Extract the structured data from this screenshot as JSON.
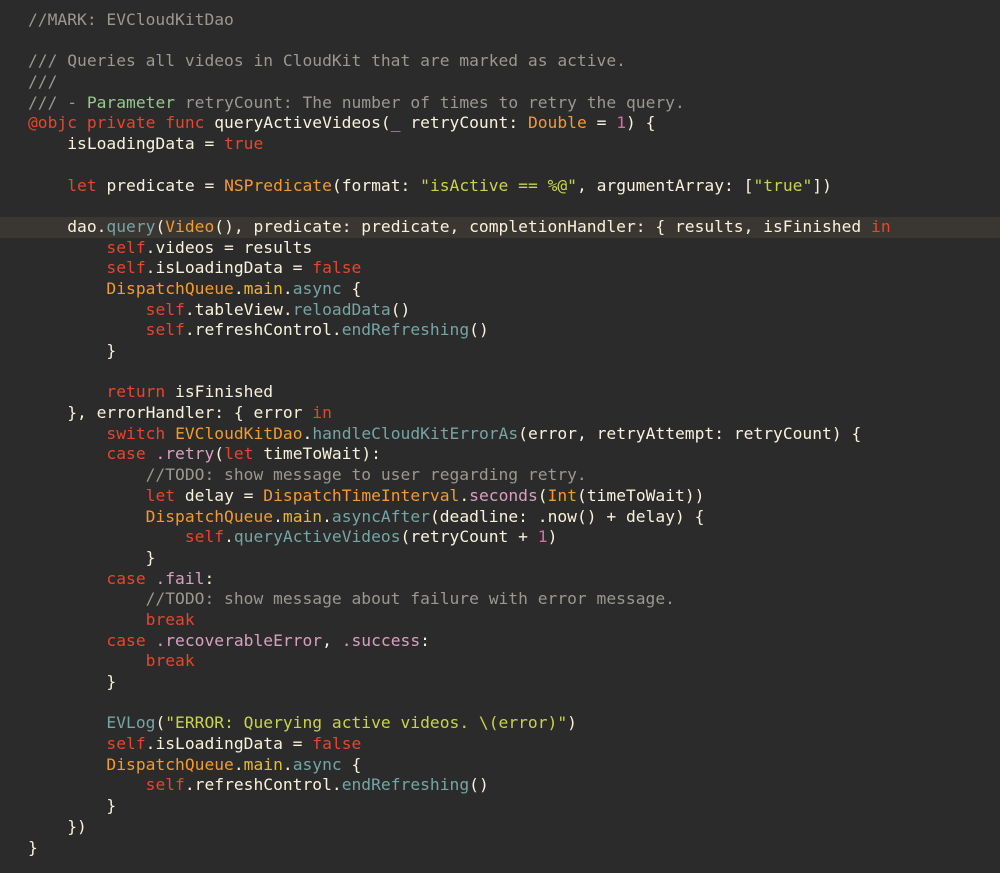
{
  "editor": {
    "language": "Swift",
    "theme": {
      "background": "#2b2b2b",
      "highlight_line_background": "#3a3632",
      "foreground": "#f8f2dc",
      "comment": "#9b9791",
      "keyword": "#e8452e",
      "type": "#f29b2e",
      "function": "#75a5a5",
      "string": "#c8d44a",
      "number": "#d96fa0",
      "enum_member": "#d8a0c0",
      "doc_param": "#96c98b",
      "property": "#e8b93a"
    },
    "highlighted_line_index": 10,
    "lines": [
      {
        "tokens": [
          {
            "t": "//MARK: EVCloudKitDao",
            "c": "comment"
          }
        ]
      },
      {
        "tokens": []
      },
      {
        "tokens": [
          {
            "t": "/// Queries all videos in CloudKit that are marked as active.",
            "c": "doc"
          }
        ]
      },
      {
        "tokens": [
          {
            "t": "///",
            "c": "doc"
          }
        ]
      },
      {
        "tokens": [
          {
            "t": "/// - ",
            "c": "doc"
          },
          {
            "t": "Parameter",
            "c": "docparam"
          },
          {
            "t": " retryCount: The number of times to retry the query.",
            "c": "doc"
          }
        ]
      },
      {
        "tokens": [
          {
            "t": "@objc private func",
            "c": "keyword"
          },
          {
            "t": " queryActiveVideos(",
            "c": "plain"
          },
          {
            "t": "_",
            "c": "member"
          },
          {
            "t": " retryCount: ",
            "c": "plain"
          },
          {
            "t": "Double",
            "c": "type"
          },
          {
            "t": " = ",
            "c": "plain"
          },
          {
            "t": "1",
            "c": "number"
          },
          {
            "t": ") {",
            "c": "plain"
          }
        ]
      },
      {
        "tokens": [
          {
            "t": "    isLoadingData = ",
            "c": "plain"
          },
          {
            "t": "true",
            "c": "keyword"
          }
        ]
      },
      {
        "tokens": []
      },
      {
        "tokens": [
          {
            "t": "    ",
            "c": "plain"
          },
          {
            "t": "let",
            "c": "keyword"
          },
          {
            "t": " predicate = ",
            "c": "plain"
          },
          {
            "t": "NSPredicate",
            "c": "type"
          },
          {
            "t": "(format: ",
            "c": "plain"
          },
          {
            "t": "\"isActive == %@\"",
            "c": "string"
          },
          {
            "t": ", argumentArray: [",
            "c": "plain"
          },
          {
            "t": "\"true\"",
            "c": "string"
          },
          {
            "t": "])",
            "c": "plain"
          }
        ]
      },
      {
        "tokens": []
      },
      {
        "tokens": [
          {
            "t": "    dao.",
            "c": "plain"
          },
          {
            "t": "query",
            "c": "func"
          },
          {
            "t": "(",
            "c": "plain"
          },
          {
            "t": "Video",
            "c": "type"
          },
          {
            "t": "(), predicate: predicate, completionHandler: { results, isFinished ",
            "c": "plain"
          },
          {
            "t": "in",
            "c": "keyword"
          }
        ]
      },
      {
        "tokens": [
          {
            "t": "        ",
            "c": "plain"
          },
          {
            "t": "self",
            "c": "keyword"
          },
          {
            "t": ".videos = results",
            "c": "plain"
          }
        ]
      },
      {
        "tokens": [
          {
            "t": "        ",
            "c": "plain"
          },
          {
            "t": "self",
            "c": "keyword"
          },
          {
            "t": ".isLoadingData = ",
            "c": "plain"
          },
          {
            "t": "false",
            "c": "keyword"
          }
        ]
      },
      {
        "tokens": [
          {
            "t": "        ",
            "c": "plain"
          },
          {
            "t": "DispatchQueue",
            "c": "type"
          },
          {
            "t": ".",
            "c": "plain"
          },
          {
            "t": "main",
            "c": "prop"
          },
          {
            "t": ".",
            "c": "plain"
          },
          {
            "t": "async",
            "c": "func"
          },
          {
            "t": " {",
            "c": "plain"
          }
        ]
      },
      {
        "tokens": [
          {
            "t": "            ",
            "c": "plain"
          },
          {
            "t": "self",
            "c": "keyword"
          },
          {
            "t": ".tableView.",
            "c": "plain"
          },
          {
            "t": "reloadData",
            "c": "func"
          },
          {
            "t": "()",
            "c": "plain"
          }
        ]
      },
      {
        "tokens": [
          {
            "t": "            ",
            "c": "plain"
          },
          {
            "t": "self",
            "c": "keyword"
          },
          {
            "t": ".refreshControl.",
            "c": "plain"
          },
          {
            "t": "endRefreshing",
            "c": "func"
          },
          {
            "t": "()",
            "c": "plain"
          }
        ]
      },
      {
        "tokens": [
          {
            "t": "        }",
            "c": "plain"
          }
        ]
      },
      {
        "tokens": []
      },
      {
        "tokens": [
          {
            "t": "        ",
            "c": "plain"
          },
          {
            "t": "return",
            "c": "keyword"
          },
          {
            "t": " isFinished",
            "c": "plain"
          }
        ]
      },
      {
        "tokens": [
          {
            "t": "    }, errorHandler: { error ",
            "c": "plain"
          },
          {
            "t": "in",
            "c": "keyword"
          }
        ]
      },
      {
        "tokens": [
          {
            "t": "        ",
            "c": "plain"
          },
          {
            "t": "switch",
            "c": "keyword"
          },
          {
            "t": " ",
            "c": "plain"
          },
          {
            "t": "EVCloudKitDao",
            "c": "type"
          },
          {
            "t": ".",
            "c": "plain"
          },
          {
            "t": "handleCloudKitErrorAs",
            "c": "func"
          },
          {
            "t": "(error, retryAttempt: retryCount) {",
            "c": "plain"
          }
        ]
      },
      {
        "tokens": [
          {
            "t": "        ",
            "c": "plain"
          },
          {
            "t": "case",
            "c": "keyword"
          },
          {
            "t": " ",
            "c": "plain"
          },
          {
            "t": ".retry",
            "c": "member"
          },
          {
            "t": "(",
            "c": "plain"
          },
          {
            "t": "let",
            "c": "keyword"
          },
          {
            "t": " timeToWait):",
            "c": "plain"
          }
        ]
      },
      {
        "tokens": [
          {
            "t": "            //TODO: show message to user regarding retry.",
            "c": "comment"
          }
        ]
      },
      {
        "tokens": [
          {
            "t": "            ",
            "c": "plain"
          },
          {
            "t": "let",
            "c": "keyword"
          },
          {
            "t": " delay = ",
            "c": "plain"
          },
          {
            "t": "DispatchTimeInterval",
            "c": "type"
          },
          {
            "t": ".",
            "c": "plain"
          },
          {
            "t": "seconds",
            "c": "member"
          },
          {
            "t": "(",
            "c": "plain"
          },
          {
            "t": "Int",
            "c": "type"
          },
          {
            "t": "(timeToWait))",
            "c": "plain"
          }
        ]
      },
      {
        "tokens": [
          {
            "t": "            ",
            "c": "plain"
          },
          {
            "t": "DispatchQueue",
            "c": "type"
          },
          {
            "t": ".",
            "c": "plain"
          },
          {
            "t": "main",
            "c": "prop"
          },
          {
            "t": ".",
            "c": "plain"
          },
          {
            "t": "asyncAfter",
            "c": "func"
          },
          {
            "t": "(deadline: .now() + delay) {",
            "c": "plain"
          }
        ]
      },
      {
        "tokens": [
          {
            "t": "                ",
            "c": "plain"
          },
          {
            "t": "self",
            "c": "keyword"
          },
          {
            "t": ".",
            "c": "plain"
          },
          {
            "t": "queryActiveVideos",
            "c": "func"
          },
          {
            "t": "(retryCount + ",
            "c": "plain"
          },
          {
            "t": "1",
            "c": "number"
          },
          {
            "t": ")",
            "c": "plain"
          }
        ]
      },
      {
        "tokens": [
          {
            "t": "            }",
            "c": "plain"
          }
        ]
      },
      {
        "tokens": [
          {
            "t": "        ",
            "c": "plain"
          },
          {
            "t": "case",
            "c": "keyword"
          },
          {
            "t": " ",
            "c": "plain"
          },
          {
            "t": ".fail",
            "c": "member"
          },
          {
            "t": ":",
            "c": "plain"
          }
        ]
      },
      {
        "tokens": [
          {
            "t": "            //TODO: show message about failure with error message.",
            "c": "comment"
          }
        ]
      },
      {
        "tokens": [
          {
            "t": "            ",
            "c": "plain"
          },
          {
            "t": "break",
            "c": "keyword"
          }
        ]
      },
      {
        "tokens": [
          {
            "t": "        ",
            "c": "plain"
          },
          {
            "t": "case",
            "c": "keyword"
          },
          {
            "t": " ",
            "c": "plain"
          },
          {
            "t": ".recoverableError",
            "c": "member"
          },
          {
            "t": ", ",
            "c": "plain"
          },
          {
            "t": ".success",
            "c": "member"
          },
          {
            "t": ":",
            "c": "plain"
          }
        ]
      },
      {
        "tokens": [
          {
            "t": "            ",
            "c": "plain"
          },
          {
            "t": "break",
            "c": "keyword"
          }
        ]
      },
      {
        "tokens": [
          {
            "t": "        }",
            "c": "plain"
          }
        ]
      },
      {
        "tokens": []
      },
      {
        "tokens": [
          {
            "t": "        ",
            "c": "plain"
          },
          {
            "t": "EVLog",
            "c": "func"
          },
          {
            "t": "(",
            "c": "plain"
          },
          {
            "t": "\"ERROR: Querying active videos. \\(error)\"",
            "c": "string"
          },
          {
            "t": ")",
            "c": "plain"
          }
        ]
      },
      {
        "tokens": [
          {
            "t": "        ",
            "c": "plain"
          },
          {
            "t": "self",
            "c": "keyword"
          },
          {
            "t": ".isLoadingData = ",
            "c": "plain"
          },
          {
            "t": "false",
            "c": "keyword"
          }
        ]
      },
      {
        "tokens": [
          {
            "t": "        ",
            "c": "plain"
          },
          {
            "t": "DispatchQueue",
            "c": "type"
          },
          {
            "t": ".",
            "c": "plain"
          },
          {
            "t": "main",
            "c": "prop"
          },
          {
            "t": ".",
            "c": "plain"
          },
          {
            "t": "async",
            "c": "func"
          },
          {
            "t": " {",
            "c": "plain"
          }
        ]
      },
      {
        "tokens": [
          {
            "t": "            ",
            "c": "plain"
          },
          {
            "t": "self",
            "c": "keyword"
          },
          {
            "t": ".refreshControl.",
            "c": "plain"
          },
          {
            "t": "endRefreshing",
            "c": "func"
          },
          {
            "t": "()",
            "c": "plain"
          }
        ]
      },
      {
        "tokens": [
          {
            "t": "        }",
            "c": "plain"
          }
        ]
      },
      {
        "tokens": [
          {
            "t": "    })",
            "c": "plain"
          }
        ]
      },
      {
        "tokens": [
          {
            "t": "}",
            "c": "plain"
          }
        ]
      }
    ]
  }
}
